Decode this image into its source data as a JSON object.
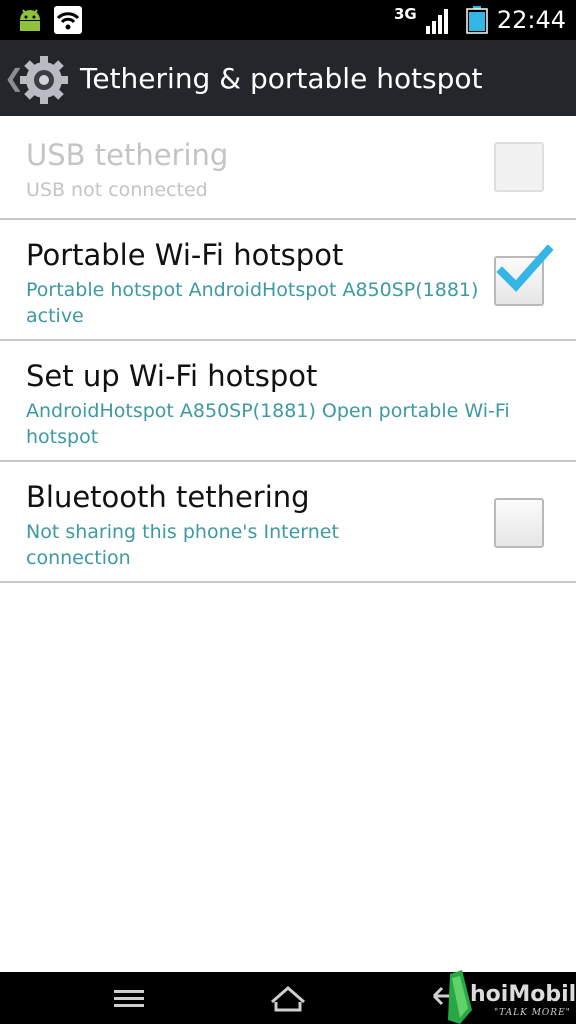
{
  "status_bar": {
    "network_type": "3G",
    "time": "22:44",
    "icons": [
      "android-debug-icon",
      "wifi-hotspot-icon",
      "signal-icon",
      "battery-icon"
    ]
  },
  "action_bar": {
    "title": "Tethering & portable hotspot",
    "icon": "settings-gear-icon"
  },
  "preferences": [
    {
      "title": "USB tethering",
      "summary": "USB not connected",
      "checked": false,
      "enabled": false
    },
    {
      "title": "Portable Wi-Fi hotspot",
      "summary": "Portable hotspot AndroidHotspot A850SP(1881) active",
      "checked": true,
      "enabled": true
    },
    {
      "title": "Set up Wi-Fi hotspot",
      "summary": "AndroidHotspot A850SP(1881) Open portable Wi-Fi hotspot",
      "enabled": true
    },
    {
      "title": "Bluetooth tethering",
      "summary": "Not sharing this phone's Internet connection",
      "checked": false,
      "enabled": true
    }
  ],
  "nav_bar": {
    "buttons": [
      "menu-icon",
      "home-icon",
      "back-icon"
    ]
  },
  "watermark": {
    "text": "hoiMobile",
    "tagline": "\"TALK MORE\""
  },
  "colors": {
    "accent": "#3c9aa3",
    "check": "#33b5e5",
    "action_bar": "#23262b"
  }
}
